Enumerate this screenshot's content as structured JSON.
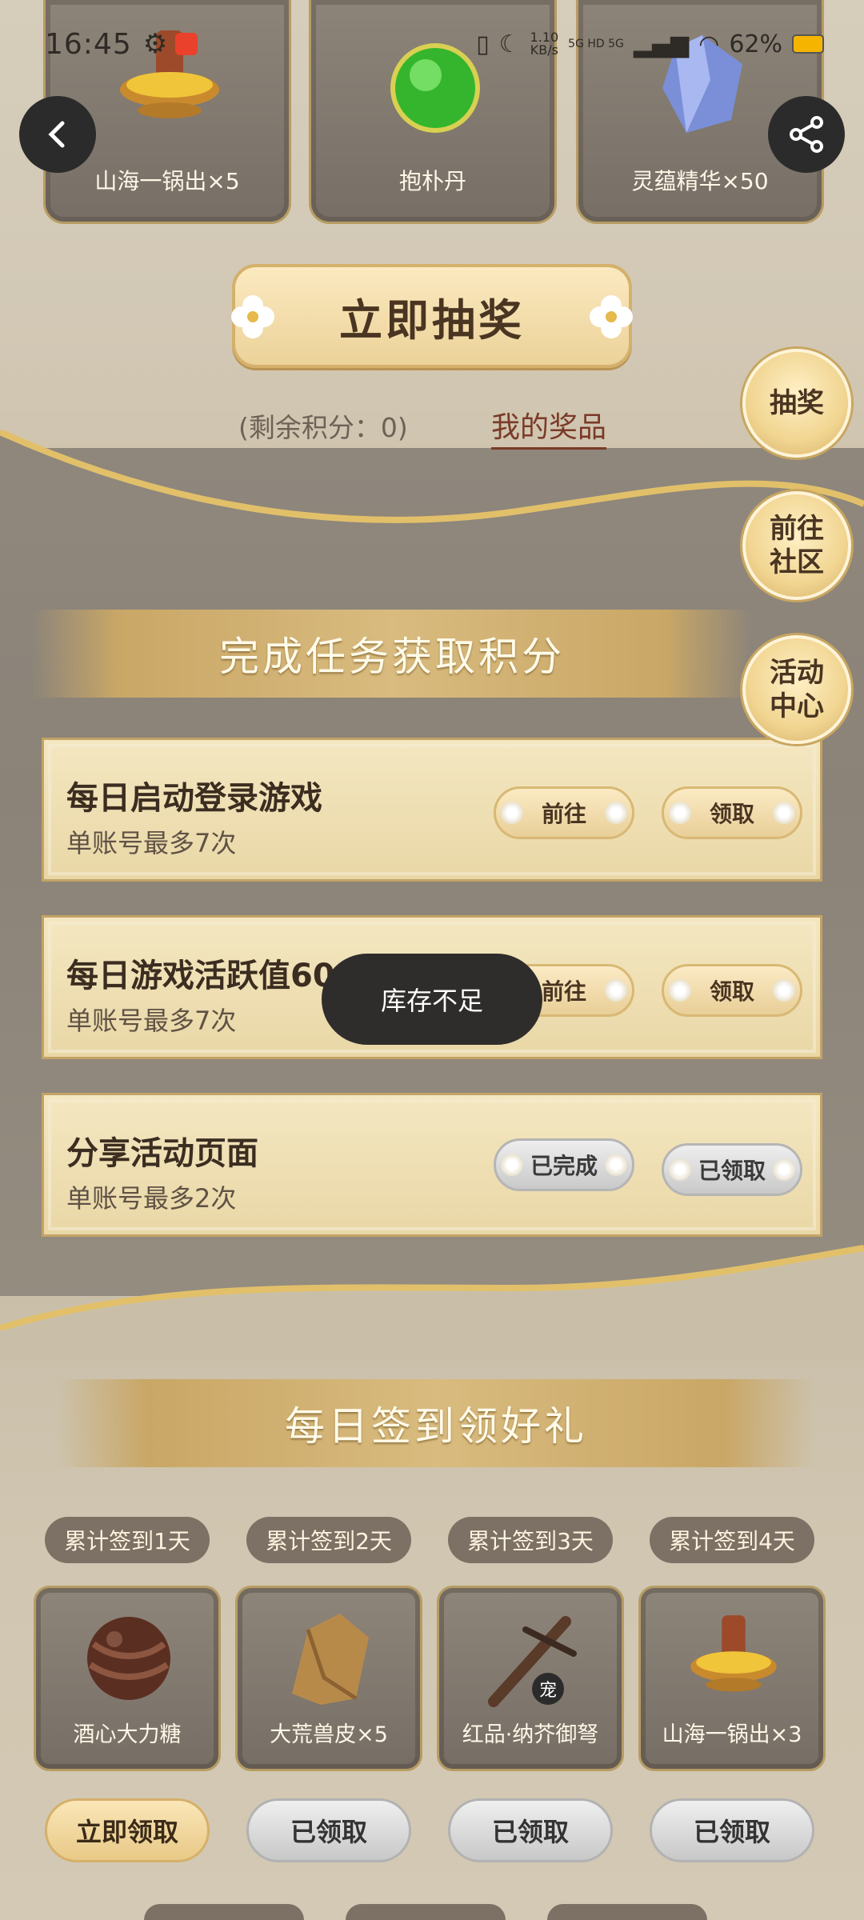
{
  "status_bar": {
    "time": "16:45",
    "net_speed_top": "1.10",
    "net_speed_bottom": "KB/s",
    "net_labels": "5G HD 5G",
    "battery": "62%"
  },
  "prizes": [
    {
      "label": "山海一锅出×5",
      "icon": "hotpot-icon"
    },
    {
      "label": "抱朴丹",
      "icon": "green-orb-icon"
    },
    {
      "label": "灵蕴精华×50",
      "icon": "crystal-icon"
    }
  ],
  "draw_button": "立即抽奖",
  "remaining_points": "(剩余积分：0)",
  "my_prizes": "我的奖品",
  "side_buttons": {
    "draw": "抽奖",
    "community_1": "前往",
    "community_2": "社区",
    "activity_1": "活动",
    "activity_2": "中心"
  },
  "task_section_title": "完成任务获取积分",
  "tasks": [
    {
      "title": "每日启动登录游戏",
      "limit": "单账号最多7次",
      "go": "前往",
      "claim": "领取"
    },
    {
      "title": "每日游戏活跃值60",
      "limit": "单账号最多7次",
      "go": "前往",
      "claim": "领取"
    },
    {
      "title": "分享活动页面",
      "limit": "单账号最多2次",
      "go": "已完成",
      "claim": "已领取"
    }
  ],
  "toast": "库存不足",
  "signin_section_title": "每日签到领好礼",
  "signin_days": [
    {
      "day": "累计签到1天",
      "reward": "酒心大力糖",
      "claim": "立即领取",
      "icon": "chocolate-ball-icon"
    },
    {
      "day": "累计签到2天",
      "reward": "大荒兽皮×5",
      "claim": "已领取",
      "icon": "beast-hide-icon"
    },
    {
      "day": "累计签到3天",
      "reward": "红品·纳芥御弩",
      "claim": "已领取",
      "icon": "crossbow-icon",
      "badge": "宠"
    },
    {
      "day": "累计签到4天",
      "reward": "山海一锅出×3",
      "claim": "已领取",
      "icon": "hotpot-icon"
    }
  ],
  "colors": {
    "gold": "#d4b06b",
    "accent_red": "#7b3a28",
    "card_dark": "#7e766c"
  }
}
